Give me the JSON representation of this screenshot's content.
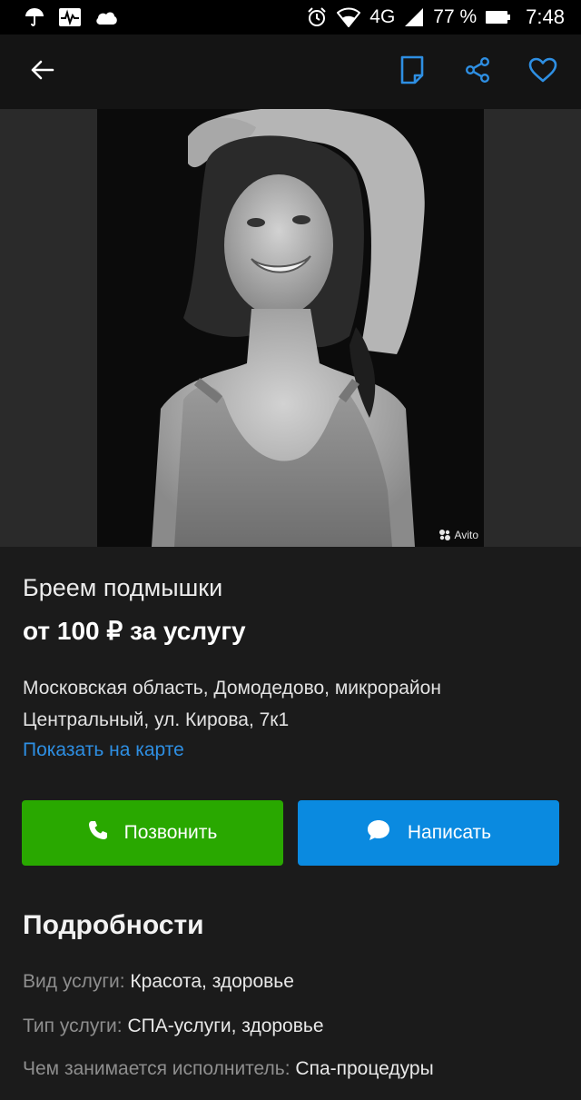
{
  "status_bar": {
    "network": "4G",
    "battery": "77 %",
    "time": "7:48",
    "icons": [
      "umbrella-icon",
      "pulse-icon",
      "cloud-icon",
      "alarm-icon",
      "wifi-icon",
      "signal-icon",
      "battery-icon"
    ]
  },
  "toolbar": {
    "icons": [
      "back-arrow-icon",
      "note-icon",
      "share-icon",
      "heart-icon"
    ],
    "accent": "#2e8fe3"
  },
  "photo": {
    "watermark": "Avito"
  },
  "listing": {
    "title": "Бреем подмышки",
    "price": "от 100 ₽ за услугу",
    "address": "Московская область, Домодедово, микрорайон Центральный, ул. Кирова, 7к1",
    "map_link": "Показать на карте"
  },
  "actions": {
    "call_label": "Позвонить",
    "message_label": "Написать",
    "call_color": "#29a800",
    "message_color": "#0a8ae0"
  },
  "details": {
    "heading": "Подробности",
    "rows": [
      {
        "key": "Вид услуги:",
        "value": "Красота, здоровье"
      },
      {
        "key": "Тип услуги:",
        "value": "СПА-услуги, здоровье"
      },
      {
        "key": "Чем занимается исполнитель:",
        "value": "Спа-процедуры"
      }
    ]
  }
}
